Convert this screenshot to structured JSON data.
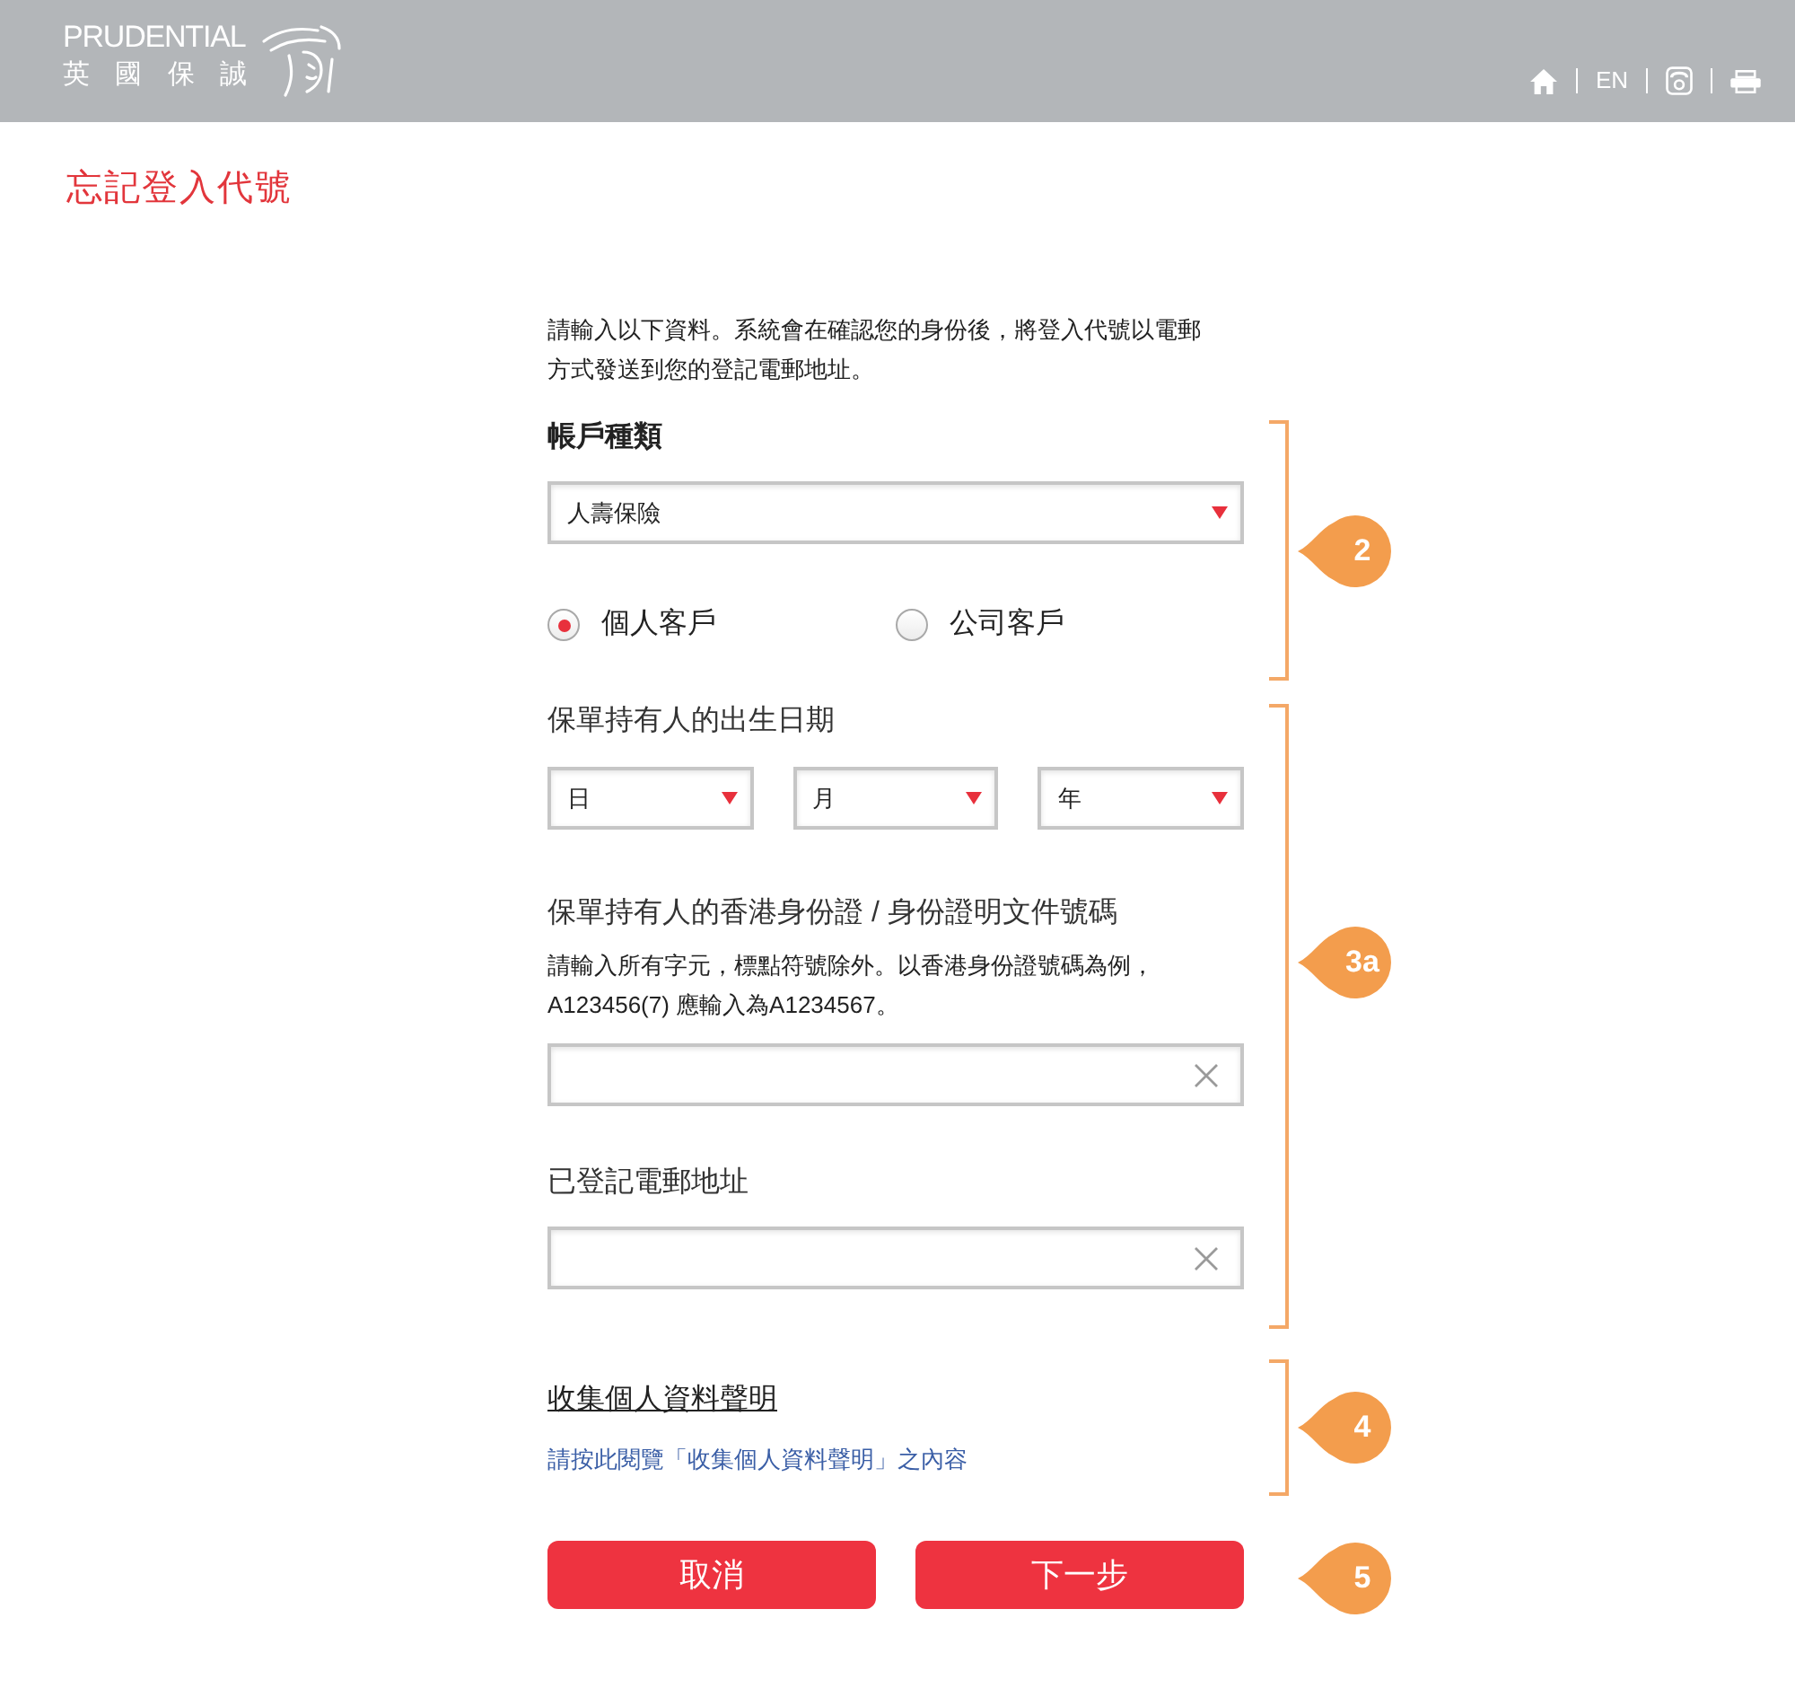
{
  "header": {
    "logo": {
      "wordmark": "PRUDENTIAL",
      "chinese_name": "英 國 保 誠"
    },
    "language": "EN"
  },
  "page_title": "忘記登入代號",
  "intro": "請輸入以下資料。系統會在確認您的身份後，將登入代號以電郵方式發送到您的登記電郵地址。",
  "account_type": {
    "step": "2",
    "label": "帳戶種類",
    "select": {
      "value": "人壽保險"
    },
    "customer_types": [
      {
        "label": "個人客戶",
        "selected": true
      },
      {
        "label": "公司客戶",
        "selected": false
      }
    ]
  },
  "policyholder": {
    "step": "3a",
    "date_of_birth": {
      "label": "保單持有人的出生日期",
      "selects": [
        {
          "placeholder": "日"
        },
        {
          "placeholder": "月"
        },
        {
          "placeholder": "年"
        }
      ]
    },
    "id_document": {
      "label": "保單持有人的香港身份證 / 身份證明文件號碼",
      "hint": "請輸入所有字元，標點符號除外。以香港身份證號碼為例，A123456(7) 應輸入為A1234567。"
    },
    "email": {
      "label": "已登記電郵地址"
    }
  },
  "privacy_statement": {
    "step": "4",
    "title": "收集個人資料聲明",
    "link": "請按此閱覽「收集個人資料聲明」之內容"
  },
  "actions": {
    "step": "5",
    "buttons": [
      {
        "label": "取消"
      },
      {
        "label": "下一步"
      }
    ]
  }
}
